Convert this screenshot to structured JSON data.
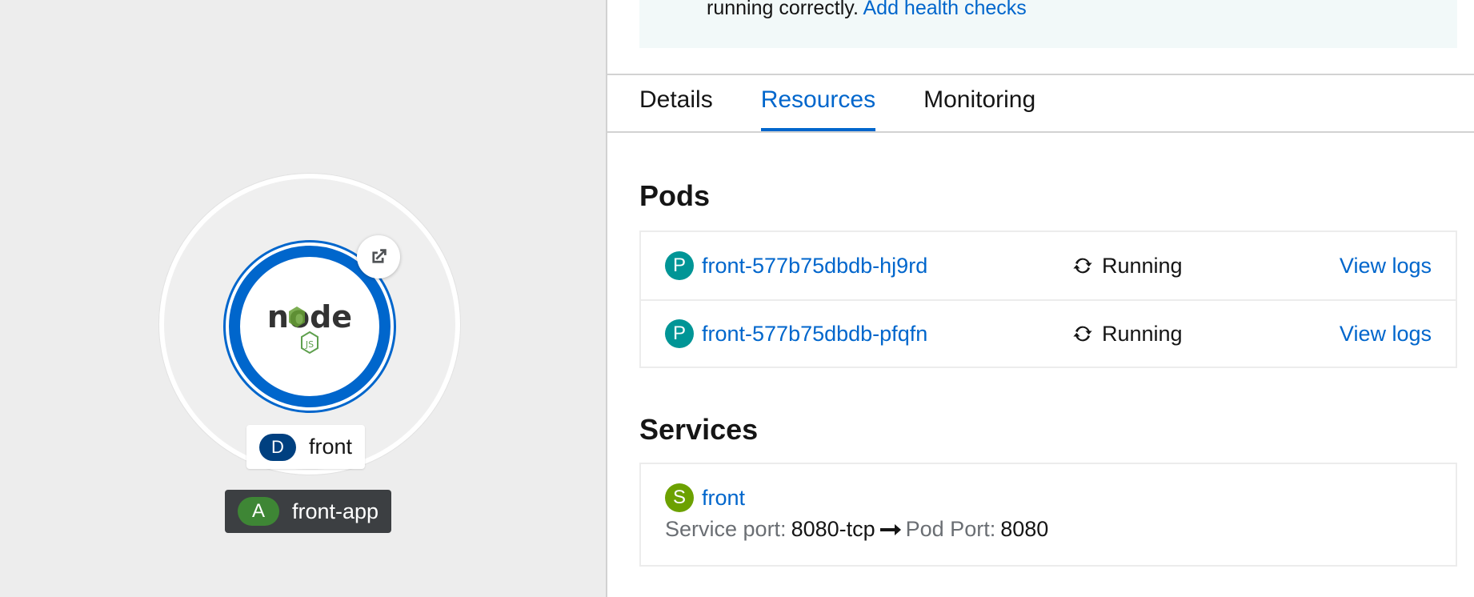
{
  "topology": {
    "node": {
      "name": "front",
      "kind_badge": "D",
      "logo_text": "node",
      "logo_subtext": "JS"
    },
    "application": {
      "name": "front-app",
      "kind_badge": "A"
    },
    "colors": {
      "ring": "#0066cc",
      "deployment_badge": "#004080",
      "app_badge": "#3e8635"
    }
  },
  "panel": {
    "alert": {
      "text": "running correctly.",
      "link": "Add health checks"
    },
    "tabs": [
      {
        "label": "Details",
        "active": false
      },
      {
        "label": "Resources",
        "active": true
      },
      {
        "label": "Monitoring",
        "active": false
      }
    ],
    "pods": {
      "title": "Pods",
      "items": [
        {
          "badge": "P",
          "name": "front-577b75dbdb-hj9rd",
          "status": "Running",
          "action": "View logs"
        },
        {
          "badge": "P",
          "name": "front-577b75dbdb-pfqfn",
          "status": "Running",
          "action": "View logs"
        }
      ]
    },
    "services": {
      "title": "Services",
      "items": [
        {
          "badge": "S",
          "name": "front",
          "service_port_label": "Service port:",
          "service_port": "8080-tcp",
          "pod_port_label": "Pod Port:",
          "pod_port": "8080"
        }
      ]
    }
  }
}
